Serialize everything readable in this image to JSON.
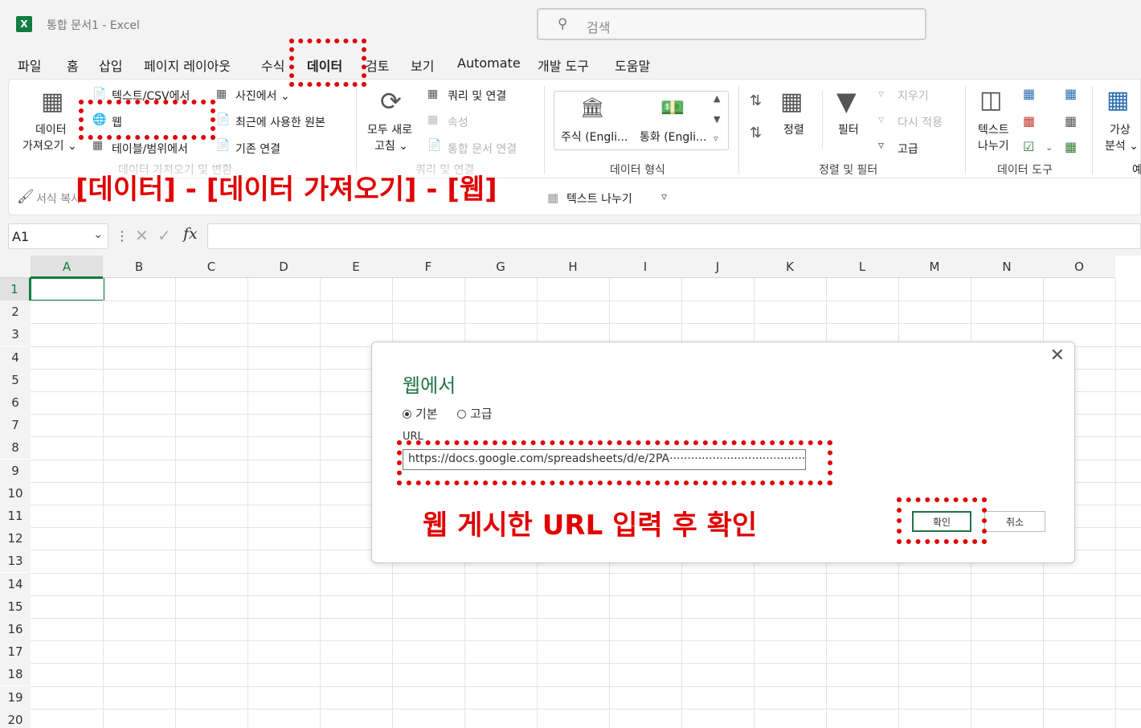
{
  "titlebar": {
    "app_icon": "excel-icon",
    "app_letter": "X",
    "doc_title": "통합 문서1  -  Excel",
    "search_placeholder": "검색"
  },
  "menu": [
    "파일",
    "홈",
    "삽입",
    "페이지 레이아웃",
    "수식",
    "데이터",
    "검토",
    "보기",
    "Automate",
    "개발 도구",
    "도움말"
  ],
  "ribbon": {
    "get_data": {
      "line1": "데이터",
      "line2": "가져오기 ⌄"
    },
    "from_text_csv": "텍스트/CSV에서",
    "from_web": "웹",
    "from_table_range": "테이블/범위에서",
    "from_picture": "사진에서 ⌄",
    "recent_sources": "최근에 사용한 원본",
    "existing_connections": "기존 연결",
    "group_get_transform": "데이터 가져오기 및 변환",
    "refresh_all": {
      "line1": "모두 새로",
      "line2": "고침 ⌄"
    },
    "queries_connections": "쿼리 및 연결",
    "properties": "속성",
    "workbook_links": "통합 문서 연결",
    "group_queries": "쿼리 및 연결",
    "stocks": "주식 (Engli...",
    "currencies": "통화 (Engli...",
    "group_data_types": "데이터 형식",
    "sort": "정렬",
    "filter": "필터",
    "clear": "지우기",
    "reapply": "다시 적용",
    "advanced": "고급",
    "group_sort_filter": "정렬 및 필터",
    "text_to_columns": {
      "line1": "텍스트",
      "line2": "나누기"
    },
    "group_data_tools": "데이터 도구",
    "what_if": {
      "line1": "가상",
      "line2": "분석 ⌄"
    },
    "forecast_cut": "예",
    "row2": {
      "format_copy": "서식 복사",
      "text_split": "텍스트 나누기"
    }
  },
  "formula_bar": {
    "name_box": "A1",
    "fx": "fx"
  },
  "grid": {
    "columns": [
      "A",
      "B",
      "C",
      "D",
      "E",
      "F",
      "G",
      "H",
      "I",
      "J",
      "K",
      "L",
      "M",
      "N",
      "O"
    ],
    "rows": [
      "1",
      "2",
      "3",
      "4",
      "5",
      "6",
      "7",
      "8",
      "9",
      "10",
      "11",
      "12",
      "13",
      "14",
      "15",
      "16",
      "17",
      "18",
      "19",
      "20"
    ]
  },
  "dialog": {
    "title": "웹에서",
    "radio_basic": "기본",
    "radio_advanced": "고급",
    "url_label": "URL",
    "url_value": "https://docs.google.com/spreadsheets/d/e/2PA··········································P",
    "ok": "확인",
    "cancel": "취소"
  },
  "annotations": {
    "path": "[데이터] - [데이터 가져오기] - [웹]",
    "instruction": "웹 게시한 URL 입력 후 확인"
  },
  "colors": {
    "accent_green": "#217346",
    "highlight_red": "#e00000"
  }
}
